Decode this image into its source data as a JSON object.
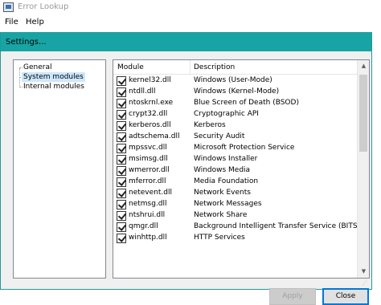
{
  "main_window": {
    "title": "Error Lookup",
    "menu": [
      "File",
      "Help"
    ]
  },
  "dialog": {
    "title": "Settings...",
    "tree": [
      {
        "label": "General",
        "selected": false
      },
      {
        "label": "System modules",
        "selected": true
      },
      {
        "label": "Internal modules",
        "selected": false
      }
    ],
    "list": {
      "columns": [
        "Module",
        "Description"
      ],
      "rows": [
        {
          "module": "kernel32.dll",
          "description": "Windows (User-Mode)",
          "checked": true
        },
        {
          "module": "ntdll.dll",
          "description": "Windows (Kernel-Mode)",
          "checked": true
        },
        {
          "module": "ntoskrnl.exe",
          "description": "Blue Screen of Death (BSOD)",
          "checked": true
        },
        {
          "module": "crypt32.dll",
          "description": "Cryptographic API",
          "checked": true
        },
        {
          "module": "kerberos.dll",
          "description": "Kerberos",
          "checked": true
        },
        {
          "module": "adtschema.dll",
          "description": "Security Audit",
          "checked": true
        },
        {
          "module": "mpssvc.dll",
          "description": "Microsoft Protection Service",
          "checked": true
        },
        {
          "module": "msimsg.dll",
          "description": "Windows Installer",
          "checked": true
        },
        {
          "module": "wmerror.dll",
          "description": "Windows Media",
          "checked": true
        },
        {
          "module": "mferror.dll",
          "description": "Media Foundation",
          "checked": true
        },
        {
          "module": "netevent.dll",
          "description": "Network Events",
          "checked": true
        },
        {
          "module": "netmsg.dll",
          "description": "Network Messages",
          "checked": true
        },
        {
          "module": "ntshrui.dll",
          "description": "Network Share",
          "checked": true
        },
        {
          "module": "qmgr.dll",
          "description": "Background Intelligent Transfer Service (BITS)",
          "checked": true
        },
        {
          "module": "winhttp.dll",
          "description": "HTTP Services",
          "checked": true
        }
      ]
    },
    "buttons": {
      "apply": "Apply",
      "close": "Close"
    }
  },
  "colors": {
    "accent": "#18a4a4",
    "selection": "#cce8ff",
    "default_button_border": "#0078d7"
  }
}
